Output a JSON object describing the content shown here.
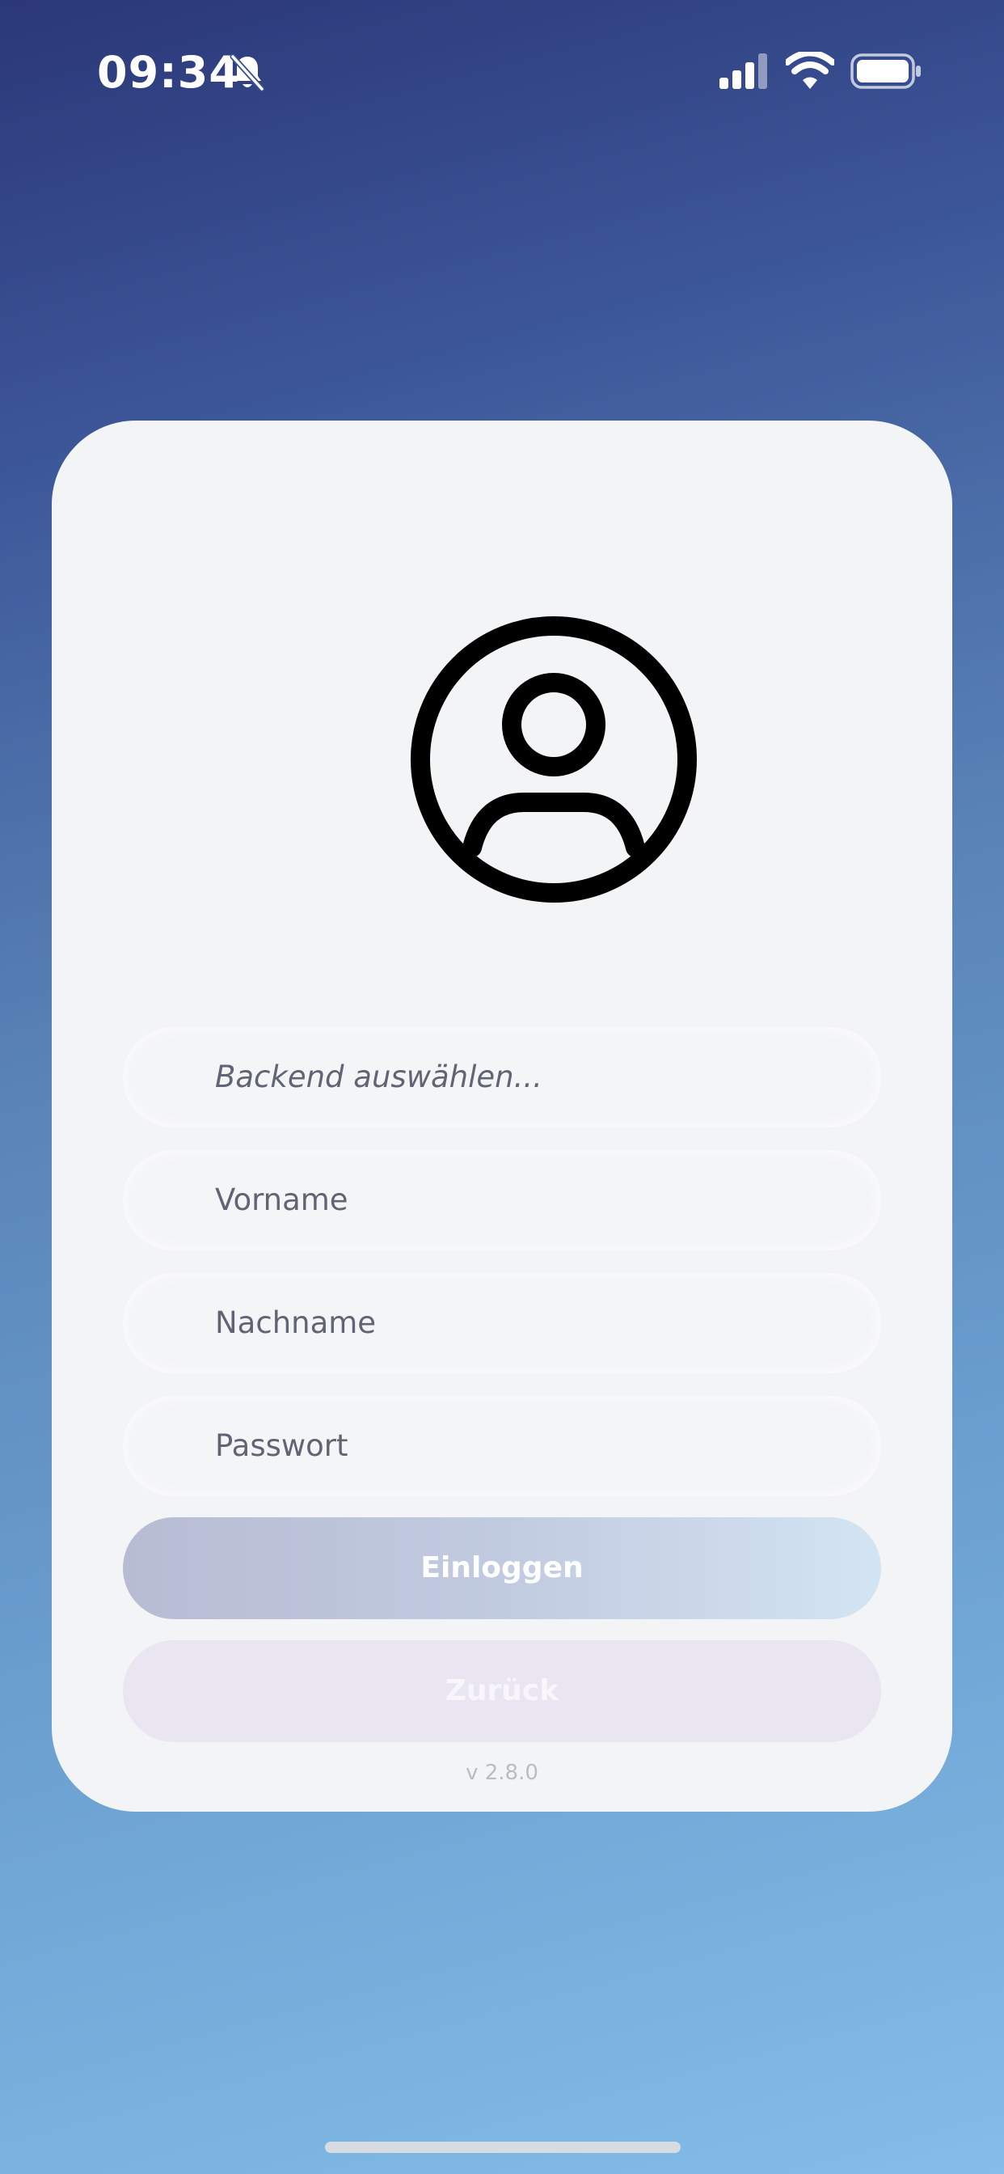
{
  "status_bar": {
    "time": "09:34",
    "icons": [
      "bell-slash-icon",
      "signal-icon",
      "wifi-icon",
      "battery-icon"
    ]
  },
  "login": {
    "avatar_icon": "user-circle-icon",
    "backend_placeholder": "Backend auswählen...",
    "firstname_placeholder": "Vorname",
    "lastname_placeholder": "Nachname",
    "password_placeholder": "Passwort",
    "login_label": "Einloggen",
    "back_label": "Zurück",
    "version": "v 2.8.0"
  },
  "colors": {
    "background_top": "#2b3778",
    "background_bottom": "#84bde8",
    "card": "#f3f4f6",
    "placeholder_text": "#5f6574"
  }
}
